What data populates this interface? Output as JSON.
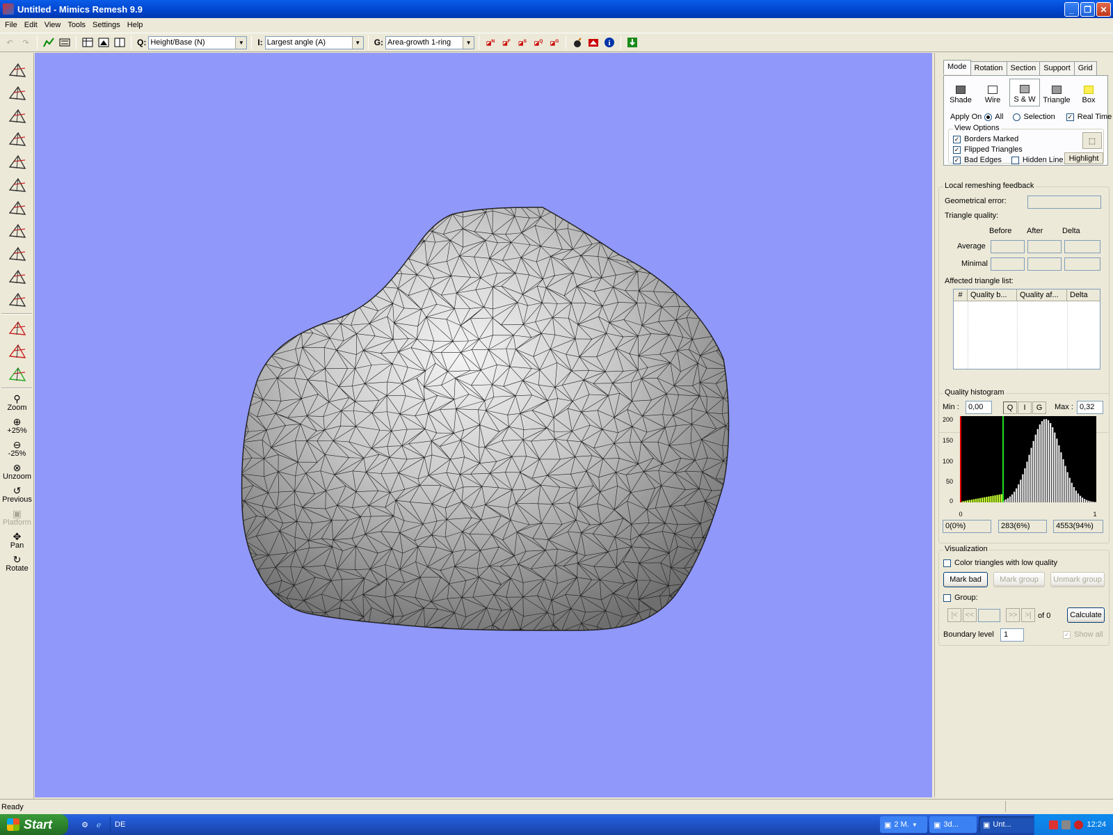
{
  "window": {
    "title": "Untitled - Mimics Remesh 9.9"
  },
  "menu": [
    "File",
    "Edit",
    "View",
    "Tools",
    "Settings",
    "Help"
  ],
  "toolbar": {
    "q_label": "Q:",
    "q_value": "Height/Base (N)",
    "i_label": "I:",
    "i_value": "Largest angle (A)",
    "g_label": "G:",
    "g_value": "Area-growth 1-ring",
    "filter_icons": [
      "N",
      "F",
      "S",
      "Q",
      "G"
    ]
  },
  "nav_tools": [
    {
      "label": "Zoom",
      "icon": "zoom-icon"
    },
    {
      "label": "+25%",
      "icon": "zoom-in-icon"
    },
    {
      "label": "-25%",
      "icon": "zoom-out-icon"
    },
    {
      "label": "Unzoom",
      "icon": "unzoom-icon"
    },
    {
      "label": "Previous",
      "icon": "previous-view-icon"
    },
    {
      "label": "Platform",
      "icon": "platform-icon",
      "disabled": true
    },
    {
      "label": "Pan",
      "icon": "pan-icon"
    },
    {
      "label": "Rotate",
      "icon": "rotate-icon"
    }
  ],
  "panel": {
    "tabs": [
      "Mode",
      "Rotation",
      "Section",
      "Support",
      "Grid"
    ],
    "mode_buttons": [
      "Shade",
      "Wire",
      "S & W",
      "Triangle",
      "Box"
    ],
    "selected_mode": "S & W",
    "apply_on": {
      "label": "Apply On",
      "options": [
        "All",
        "Selection"
      ],
      "selected": "All"
    },
    "real_time": {
      "label": "Real Time",
      "checked": true
    },
    "view_options": {
      "title": "View Options",
      "borders_marked": "Borders Marked",
      "flipped_triangles": "Flipped Triangles",
      "bad_edges": "Bad Edges",
      "hidden_line": "Hidden Line",
      "highlight": "Highlight"
    },
    "feedback": {
      "title": "Local remeshing feedback",
      "geom_error": "Geometrical error:",
      "triangle_quality": "Triangle quality:",
      "cols": [
        "Before",
        "After",
        "Delta"
      ],
      "rows": [
        "Average",
        "Minimal"
      ],
      "affected": "Affected triangle list:",
      "table_headers": [
        "#",
        "Quality b...",
        "Quality af...",
        "Delta"
      ]
    },
    "histogram": {
      "title": "Quality histogram",
      "min_label": "Min :",
      "min_value": "0,00",
      "max_label": "Max :",
      "max_value": "0,32",
      "buttons": [
        "Q",
        "I",
        "G"
      ],
      "y_ticks": [
        "200",
        "150",
        "100",
        "50",
        "0"
      ],
      "x_ticks": [
        "0",
        "1"
      ],
      "counts": [
        "0(0%)",
        "283(6%)",
        "4553(94%)"
      ]
    },
    "visualization": {
      "title": "Visualization",
      "color_low": "Color triangles with low quality",
      "mark_bad": "Mark bad",
      "mark_group": "Mark group",
      "unmark_group": "Unmark group",
      "group": "Group:",
      "nav_buttons": [
        "|<",
        "<<",
        ">>",
        ">|"
      ],
      "of_label": "of 0",
      "calculate": "Calculate",
      "boundary_label": "Boundary level",
      "boundary_value": "1",
      "show_all": "Show all"
    }
  },
  "status": {
    "text": "Ready"
  },
  "taskbar": {
    "start": "Start",
    "lang": "DE",
    "tasks": [
      "2 M.",
      "3d...",
      "Unt..."
    ],
    "clock": "12:24"
  },
  "colors": {
    "viewport": "#9098fa",
    "mesh": "#b8b8b8",
    "hist_bad": "#c8ff33",
    "hist_good": "#e6e6e6",
    "hist_cut": "#22dd22"
  }
}
